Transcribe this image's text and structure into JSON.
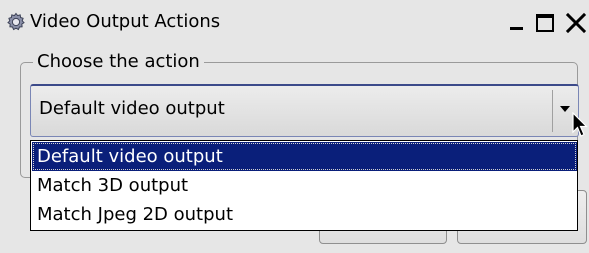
{
  "window": {
    "title": "Video Output Actions",
    "icon": "gear-icon",
    "controls": [
      "minimize-icon",
      "maximize-icon",
      "close-icon"
    ]
  },
  "group": {
    "legend": "Choose the action"
  },
  "combo": {
    "selected_value": "Default video output",
    "arrow_icon": "chevron-down-icon"
  },
  "dropdown": {
    "options": [
      {
        "label": "Default video output",
        "selected": true
      },
      {
        "label": "Match 3D output",
        "selected": false
      },
      {
        "label": "Match Jpeg 2D output",
        "selected": false
      }
    ]
  },
  "colors": {
    "selection_background": "#0a1f7a",
    "selection_text": "#ffffff",
    "window_background": "#e6e6e6"
  }
}
